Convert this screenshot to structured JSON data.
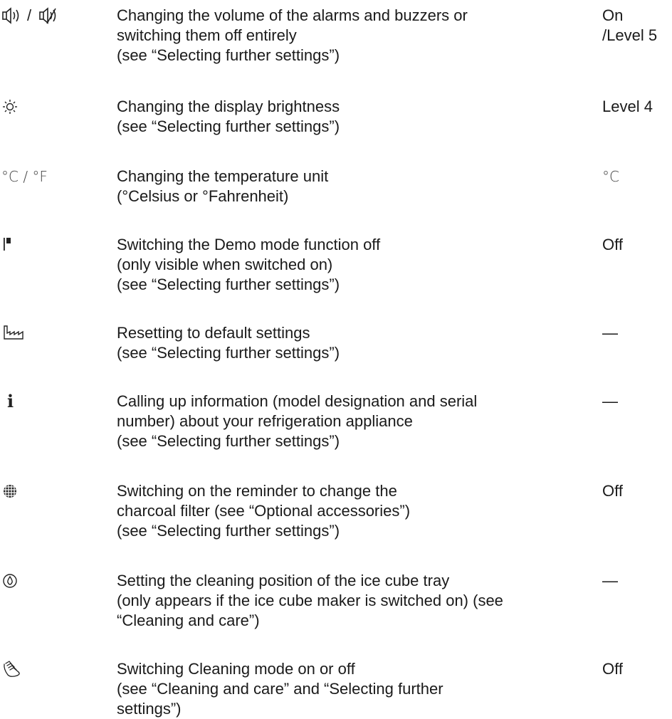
{
  "rows": [
    {
      "icon_name": "volume-on-off-icon",
      "icon_text": "",
      "lines": [
        "Changing the volume of the alarms and buzzers or",
        "switching them off entirely",
        "(see “Selecting further settings”)"
      ],
      "default": [
        "On",
        "/Level 5"
      ]
    },
    {
      "icon_name": "brightness-icon",
      "icon_text": "",
      "lines": [
        "Changing the display brightness",
        "(see “Selecting further settings”)"
      ],
      "default": [
        "Level 4"
      ]
    },
    {
      "icon_name": "temperature-unit-icon",
      "icon_text": "°C / °F",
      "lines": [
        "Changing the temperature unit",
        "(°Celsius or °Fahrenheit)"
      ],
      "default": [
        "°C"
      ]
    },
    {
      "icon_name": "demo-mode-icon",
      "icon_text": "",
      "lines": [
        "Switching the Demo mode function off",
        "(only visible when switched on)",
        "(see “Selecting further settings”)"
      ],
      "default": [
        "Off"
      ]
    },
    {
      "icon_name": "factory-reset-icon",
      "icon_text": "",
      "lines": [
        "Resetting to default settings",
        "(see “Selecting further settings”)"
      ],
      "default": [
        "—"
      ]
    },
    {
      "icon_name": "info-icon",
      "icon_text": "i",
      "lines": [
        "Calling up information (model designation and serial",
        "number) about your refrigeration appliance",
        "(see “Selecting further settings”)"
      ],
      "default": [
        "—"
      ]
    },
    {
      "icon_name": "charcoal-filter-icon",
      "icon_text": "",
      "lines": [
        "Switching on the reminder to change the",
        "charcoal filter (see “Optional accessories”)",
        "(see “Selecting further settings”)"
      ],
      "default": [
        "Off"
      ]
    },
    {
      "icon_name": "ice-tray-cleaning-icon",
      "icon_text": "",
      "lines": [
        "Setting the cleaning position of the ice cube tray",
        "(only appears if the ice cube maker is switched on) (see",
        "“Cleaning and care”)"
      ],
      "default": [
        "—"
      ]
    },
    {
      "icon_name": "cleaning-mode-icon",
      "icon_text": "",
      "lines": [
        "Switching Cleaning mode on or off",
        "(see “Cleaning and care” and “Selecting further",
        "settings”)"
      ],
      "default": [
        "Off"
      ]
    }
  ]
}
